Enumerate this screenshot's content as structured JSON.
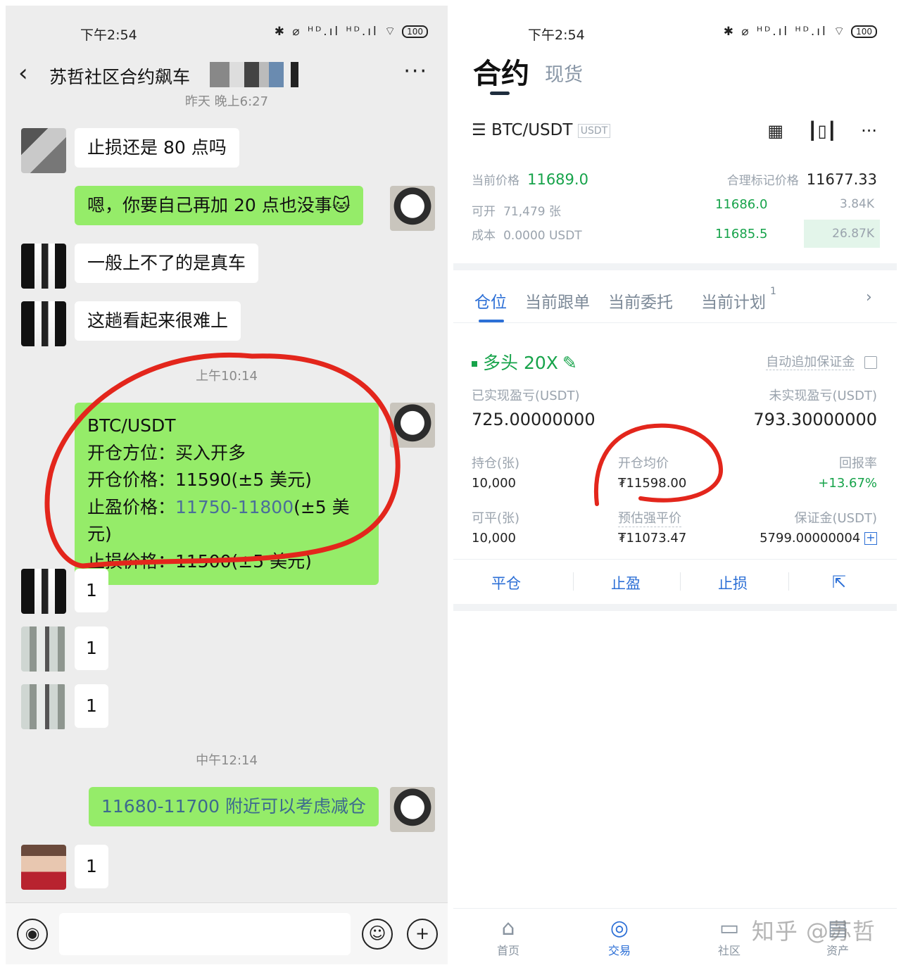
{
  "left": {
    "status": {
      "time": "下午2:54",
      "icons": "✱ ⌀ ᴴᴰ.ıl ᴴᴰ.ıl ⌔",
      "battery": "100"
    },
    "header": {
      "title": "苏哲社区合约飙车",
      "back_icon": "chevron-left-icon",
      "more_icon": "more-dots-icon"
    },
    "timestamps": {
      "t1": "昨天 晚上6:27",
      "t2": "上午10:14",
      "t3": "中午12:14"
    },
    "messages": {
      "m1": "止损还是 80 点吗",
      "m2": "嗯，你要自己再加 20 点也没事🐱",
      "m3": "一般上不了的是真车",
      "m4": "这趟看起来很难上",
      "trade": {
        "l1": "BTC/USDT",
        "l2": "开仓方位：买入开多",
        "l3": "开仓价格：11590(±5 美元)",
        "l4a": "止盈价格：",
        "l4b": "11750-11800",
        "l4c": "(±5 美元)",
        "l5": "止损价格：11500(±5 美元)"
      },
      "r1": "1",
      "r2": "1",
      "r3": "1",
      "m5": "11680-11700 附近可以考虑减仓",
      "r4": "1"
    },
    "input": {
      "voice_icon": "voice-icon",
      "emoji_icon": "emoji-icon",
      "plus_icon": "plus-icon"
    }
  },
  "right": {
    "status": {
      "time": "下午2:54",
      "battery": "100"
    },
    "tabs": {
      "main": "合约",
      "sub": "现货"
    },
    "pair": {
      "menu_icon": "☰",
      "name": "BTC/USDT",
      "tag": "USDT",
      "icons": [
        "calculator-icon",
        "candlestick-icon",
        "more-dots-icon"
      ]
    },
    "market": {
      "price_label": "当前价格",
      "price": "11689.0",
      "mark_label": "合理标记价格",
      "mark": "11677.33",
      "open_label": "可开",
      "open_value": "71,479 张",
      "cost_label": "成本",
      "cost_value": "0.0000 USDT",
      "book": [
        {
          "price": "11686.0",
          "size": "3.84K"
        },
        {
          "price": "11685.5",
          "size": "26.87K"
        }
      ]
    },
    "subtabs": [
      "仓位",
      "当前跟单",
      "当前委托",
      "当前计划"
    ],
    "subtab_badge": "1",
    "position": {
      "side": "多头 20X",
      "auto_margin": "自动追加保证金",
      "realized_label": "已实现盈亏(USDT)",
      "realized": "725.00000000",
      "unrealized_label": "未实现盈亏(USDT)",
      "unrealized": "793.30000000",
      "hold_label": "持仓(张)",
      "hold": "10,000",
      "avg_label": "开仓均价",
      "avg": "₮11598.00",
      "roe_label": "回报率",
      "roe": "+13.67%",
      "closable_label": "可平(张)",
      "closable": "10,000",
      "liq_label": "预估强平价",
      "liq": "₮11073.47",
      "margin_label": "保证金(USDT)",
      "margin": "5799.00000004"
    },
    "actions": {
      "close": "平仓",
      "tp": "止盈",
      "sl": "止损"
    },
    "nav": {
      "home": "首页",
      "trade": "交易",
      "community": "社区",
      "assets": "资产"
    },
    "watermark": "知乎 @苏哲",
    "colors": {
      "accent": "#2c6fd6",
      "up": "#16a34a",
      "wechat_green": "#95ec69",
      "annotation_red": "#e3261c"
    }
  }
}
